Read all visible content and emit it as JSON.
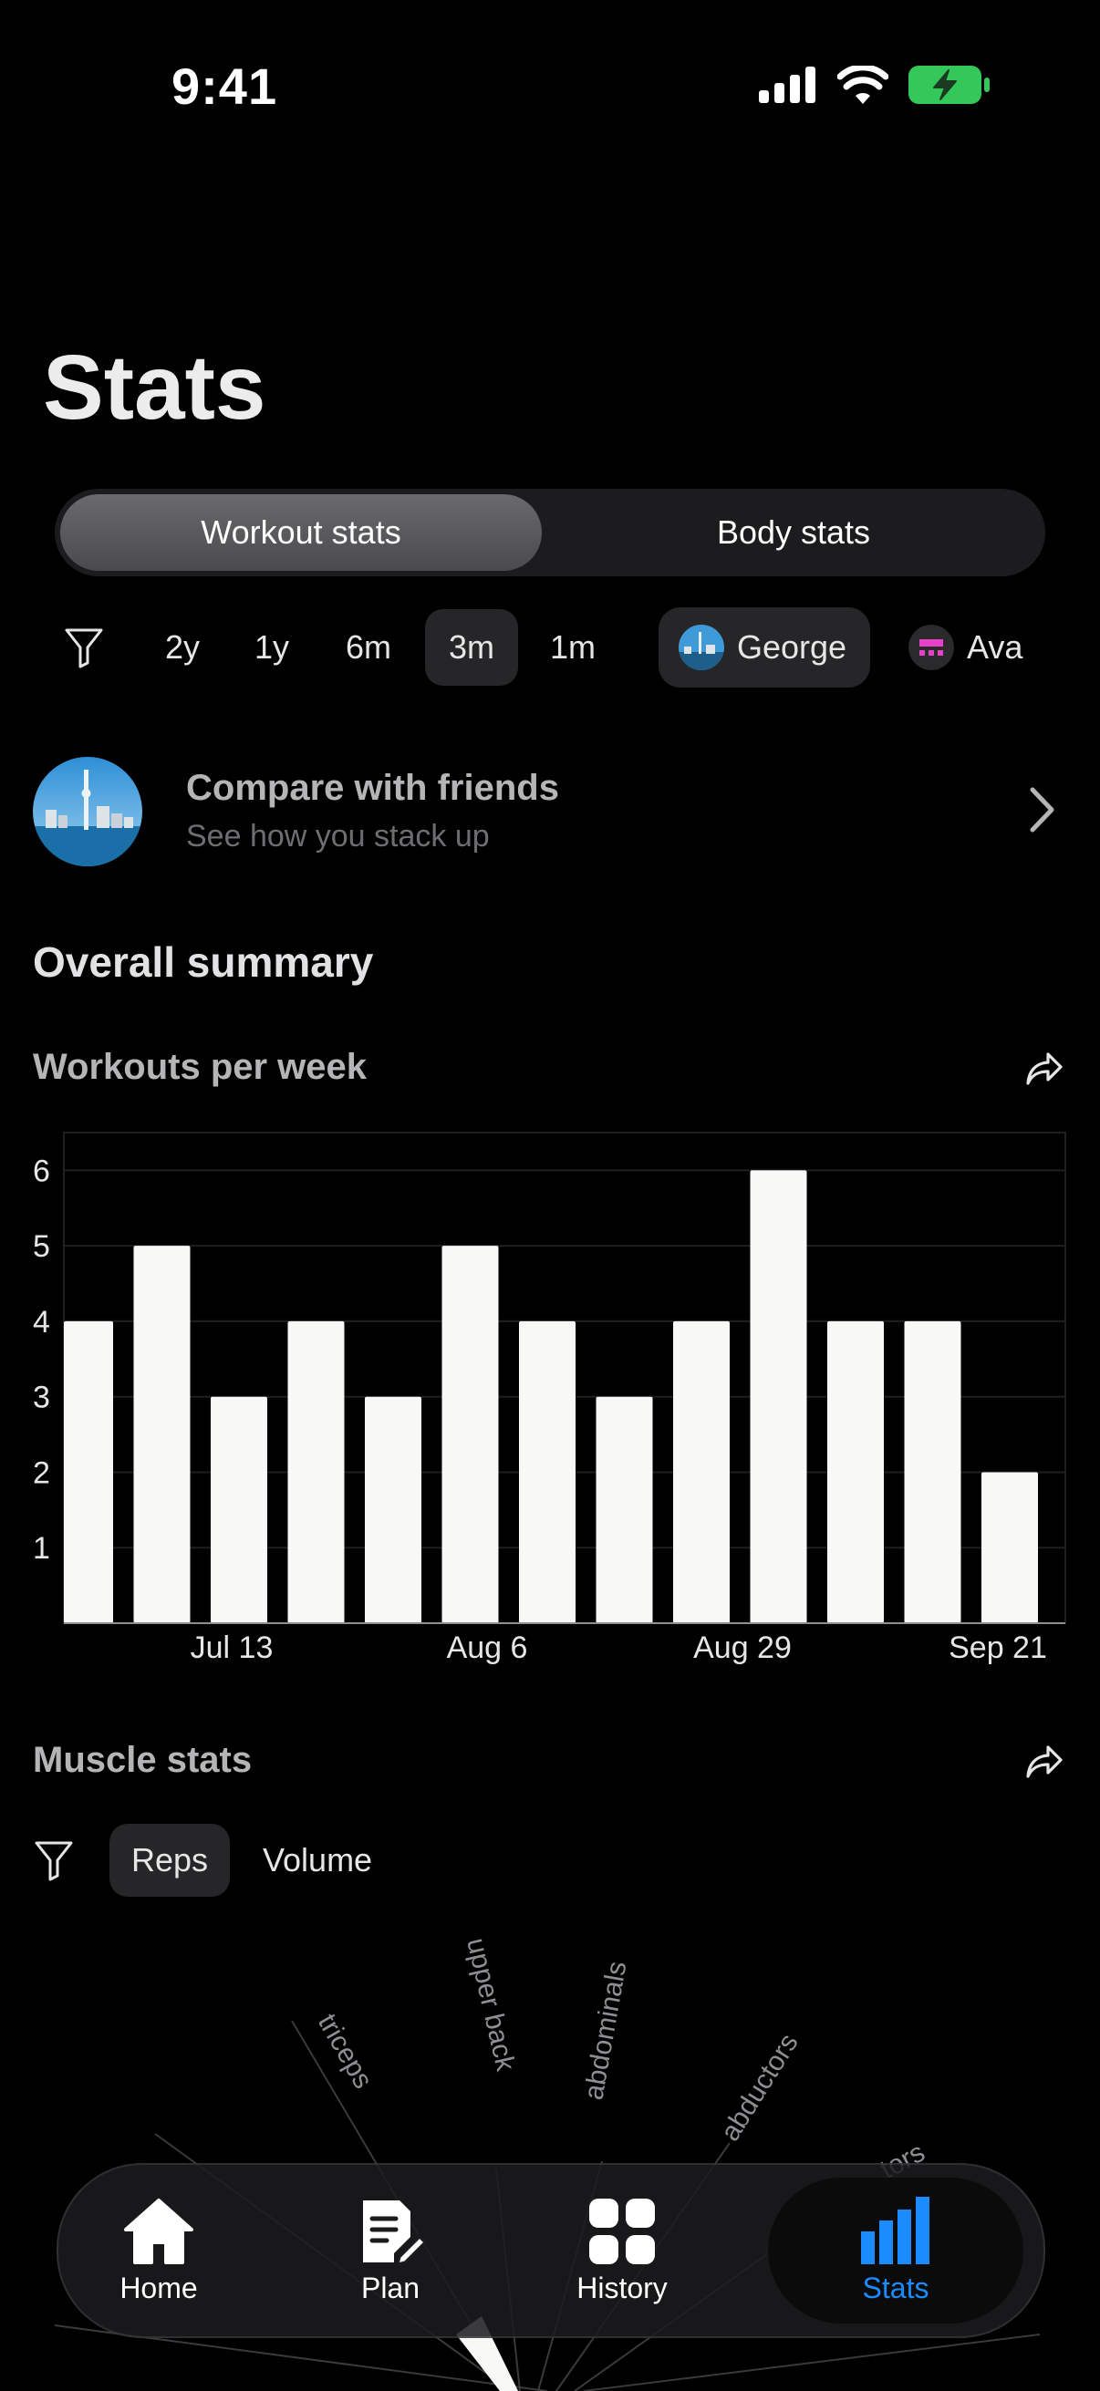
{
  "status_bar": {
    "time": "9:41",
    "battery_color": "#34c759"
  },
  "page": {
    "title": "Stats"
  },
  "segmented": {
    "workout_label": "Workout stats",
    "body_label": "Body stats",
    "selected": "Workout stats"
  },
  "range_filters": {
    "filter_icon": "filter-icon",
    "options": [
      "2y",
      "1y",
      "6m",
      "3m",
      "1m"
    ],
    "selected": "3m"
  },
  "users": [
    {
      "name": "George",
      "selected": true
    },
    {
      "name": "Ava",
      "selected": false
    }
  ],
  "compare": {
    "title": "Compare with friends",
    "subtitle": "See how you stack up"
  },
  "overall": {
    "heading": "Overall summary"
  },
  "chart_data": {
    "type": "bar",
    "title": "Workouts per week",
    "values": [
      4,
      5,
      3,
      4,
      3,
      5,
      4,
      3,
      4,
      6,
      4,
      4,
      2
    ],
    "x_tick_labels": [
      "Jul 13",
      "Aug 6",
      "Aug 29",
      "Sep 21"
    ],
    "y_ticks": [
      1,
      2,
      3,
      4,
      5,
      6
    ],
    "ylim": [
      0,
      6.5
    ],
    "grid": true,
    "bar_color": "#f8f8f6"
  },
  "muscle": {
    "heading": "Muscle stats",
    "modes": [
      "Reps",
      "Volume"
    ],
    "selected": "Reps",
    "radial_labels": [
      "triceps",
      "upper back",
      "abdominals",
      "abductors",
      "tors"
    ]
  },
  "tabs": [
    {
      "label": "Home",
      "icon": "home-icon"
    },
    {
      "label": "Plan",
      "icon": "plan-icon"
    },
    {
      "label": "History",
      "icon": "history-icon"
    },
    {
      "label": "Stats",
      "icon": "stats-icon",
      "active": true
    }
  ],
  "accent_color": "#1a8cff"
}
